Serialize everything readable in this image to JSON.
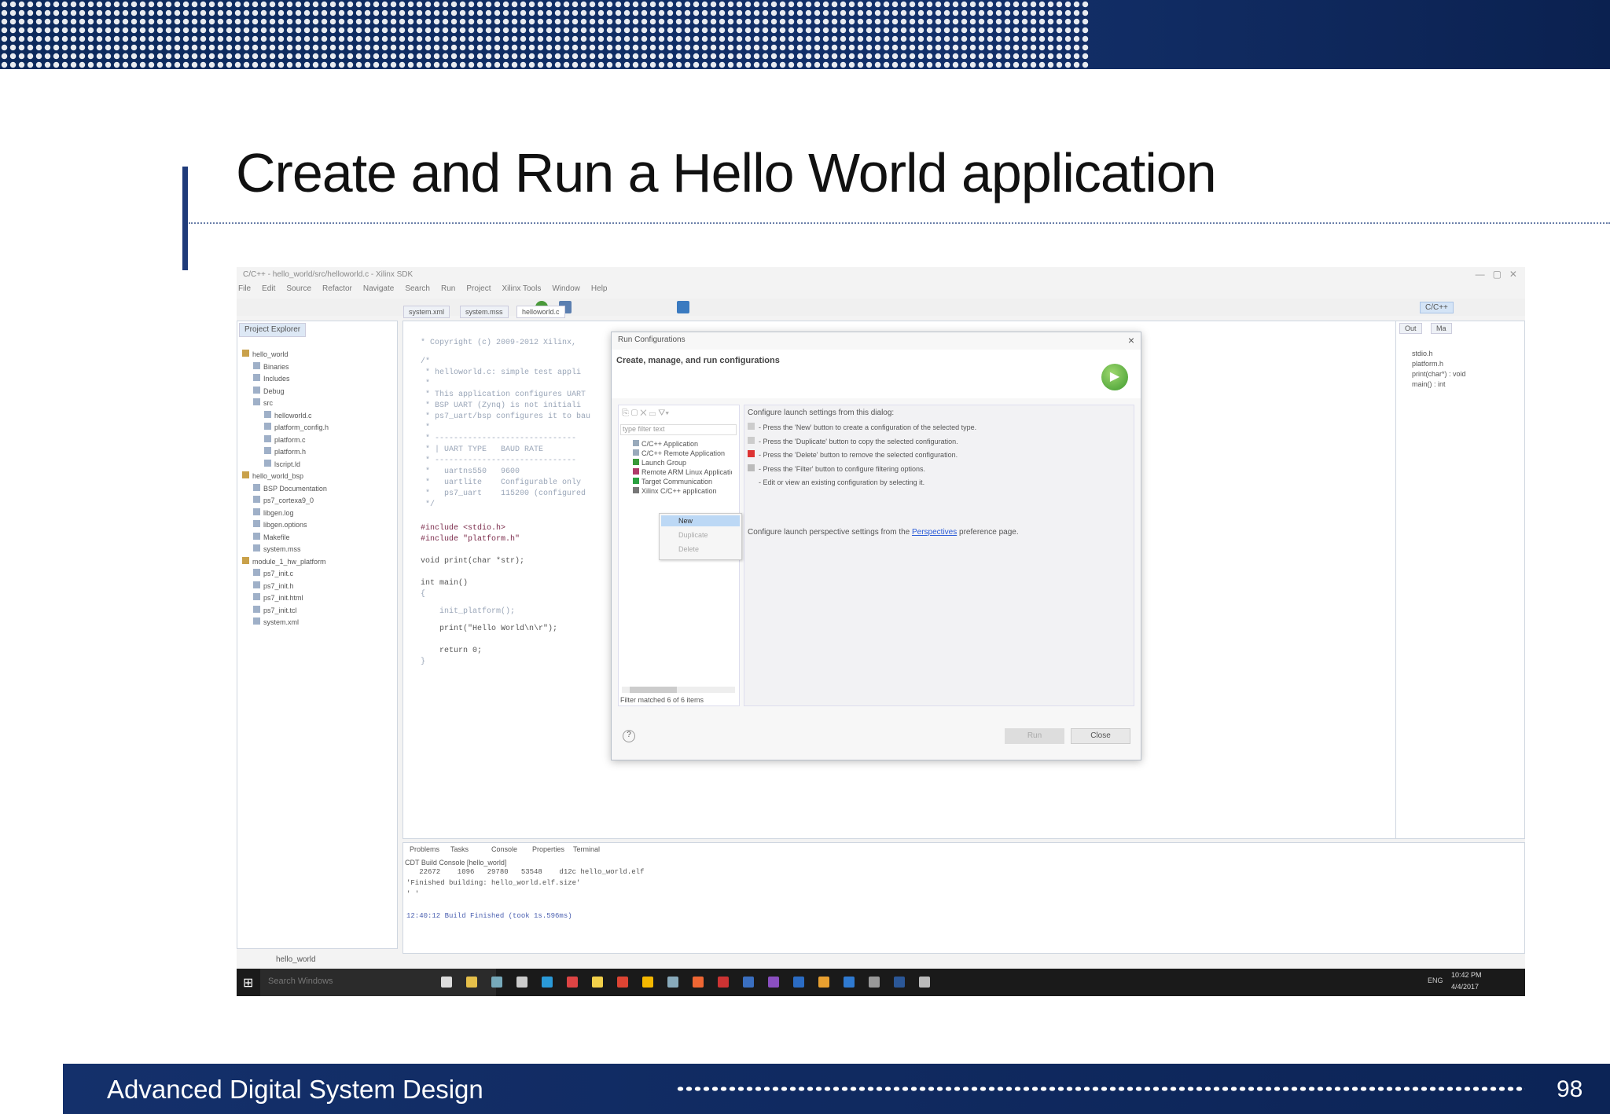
{
  "slide": {
    "title": "Create and Run a Hello World application",
    "footer": "Advanced Digital System Design",
    "page": "98"
  },
  "ide": {
    "window_title": "C/C++ - hello_world/src/helloworld.c - Xilinx SDK",
    "menu": [
      "File",
      "Edit",
      "Source",
      "Refactor",
      "Navigate",
      "Search",
      "Run",
      "Project",
      "Xilinx Tools",
      "Window",
      "Help"
    ],
    "perspective": "C/C++",
    "explorer_tab": "Project Explorer",
    "editor_tabs": [
      "system.xml",
      "system.mss",
      "helloworld.c"
    ],
    "tree": [
      "hello_world",
      "Binaries",
      "Includes",
      "Debug",
      "src",
      "helloworld.c",
      "platform_config.h",
      "platform.c",
      "platform.h",
      "lscript.ld",
      "hello_world_bsp",
      "BSP Documentation",
      "ps7_cortexa9_0",
      "libgen.log",
      "libgen.options",
      "Makefile",
      "system.mss",
      "module_1_hw_platform",
      "ps7_init.c",
      "ps7_init.h",
      "ps7_init.html",
      "ps7_init.tcl",
      "system.xml"
    ],
    "code": [
      "* Copyright (c) 2009-2012 Xilinx,",
      "/*",
      " * helloworld.c: simple test appli",
      " *",
      " * This application configures UART",
      " * BSP UART (Zynq) is not initiali",
      " * ps7_uart/bsp configures it to bau",
      " *",
      " * ------------------------------",
      " * | UART TYPE   BAUD RATE",
      " * ------------------------------",
      " *   uartns550   9600",
      " *   uartlite    Configurable only",
      " *   ps7_uart    115200 (configured",
      " */",
      "#include <stdio.h>",
      "#include \"platform.h\"",
      "void print(char *str);",
      "int main()",
      "{",
      "    init_platform();",
      "    print(\"Hello World\\n\\r\");",
      "    return 0;",
      "}"
    ],
    "outline_tabs": [
      "Out",
      "Ma"
    ],
    "outline": [
      "stdio.h",
      "platform.h",
      "print(char*) : void",
      "main() : int"
    ],
    "bottom_tabs": [
      "Problems",
      "Tasks",
      "Console",
      "Properties",
      "Terminal"
    ],
    "console_title": "CDT Build Console [hello_world]",
    "console": [
      "   22672    1096   29780   53548    d12c hello_world.elf",
      "'Finished building: hello_world.elf.size'",
      "' '",
      "",
      "12:40:12 Build Finished (took 1s.596ms)"
    ],
    "status": "hello_world",
    "taskbar": {
      "search": "Search Windows",
      "lang": "ENG",
      "time": "10:42 PM",
      "date": "4/4/2017"
    }
  },
  "dialog": {
    "title": "Run Configurations",
    "heading": "Create, manage, and run configurations",
    "filter_placeholder": "type filter text",
    "types": [
      "C/C++ Application",
      "C/C++ Remote Application",
      "Launch Group",
      "Remote ARM Linux Application",
      "Target Communication",
      "Xilinx C/C++ application"
    ],
    "context_menu": [
      "New",
      "Duplicate",
      "Delete"
    ],
    "intro": "Configure launch settings from this dialog:",
    "hints": [
      "- Press the 'New' button to create a configuration of the selected type.",
      "- Press the 'Duplicate' button to copy the selected configuration.",
      "- Press the 'Delete' button to remove the selected configuration.",
      "- Press the 'Filter' button to configure filtering options.",
      "- Edit or view an existing configuration by selecting it."
    ],
    "perspective_pre": "Configure launch perspective settings from the ",
    "perspective_link": "Perspectives",
    "perspective_post": " preference page.",
    "filter_status": "Filter matched 6 of 6 items",
    "run": "Run",
    "close": "Close",
    "close_x": "×",
    "help": "?"
  }
}
